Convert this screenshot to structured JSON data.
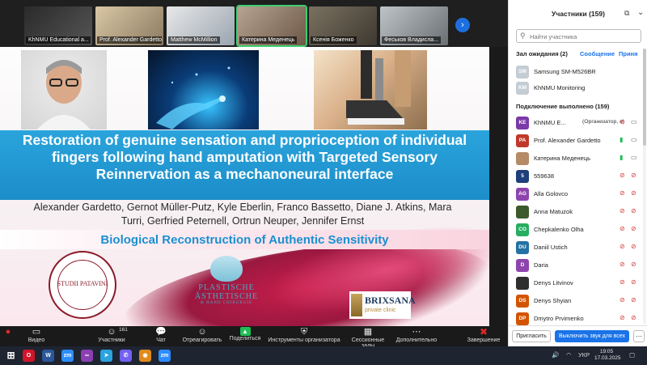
{
  "video_strip": {
    "tiles": [
      {
        "name": "KhNMU Educational a..."
      },
      {
        "name": "Prof. Alexander Gardetto"
      },
      {
        "name": "Matthew McMillion"
      },
      {
        "name": "Катерина Меденець"
      },
      {
        "name": "Ксенія Боженко"
      },
      {
        "name": "Феськов Владисла..."
      }
    ],
    "next_icon": "chevron-right"
  },
  "slide": {
    "title": "Restoration of genuine sensation and proprioception of individual fingers following hand amputation with Targeted Sensory Reinnervation as a mechanoneural interface",
    "authors": "Alexander Gardetto, Gernot Müller-Putz, Kyle Eberlin, Franco Bassetto, Diane J. Atkins, Mara Turri, Gerfried Peternell, Ortrun Neuper, Jennifer Ernst",
    "subtitle": "Biological Reconstruction of Authentic Sensitivity",
    "seal_text": "STUDII PATAVINI",
    "logo_plast_line1": "PLASTISCHE",
    "logo_plast_line2": "ÄSTHETISCHE",
    "logo_plast_line3": "& HAND CHIRURGIE",
    "logo_brix_name": "BRIXSANA",
    "logo_brix_sub": "private clinic"
  },
  "toolbar": {
    "items": [
      {
        "label": "",
        "icon": "mic-icon"
      },
      {
        "label": "Видео",
        "icon": "video-icon"
      },
      {
        "label": "Участники",
        "icon": "participants-icon",
        "count": "161"
      },
      {
        "label": "Чат",
        "icon": "chat-icon"
      },
      {
        "label": "Отреагировать",
        "icon": "react-icon"
      },
      {
        "label": "Поделиться",
        "icon": "share-icon"
      },
      {
        "label": "Инструменты организатора",
        "icon": "shield-icon"
      },
      {
        "label": "Сессионные залы",
        "icon": "rooms-icon"
      },
      {
        "label": "Дополнительно",
        "icon": "more-icon"
      },
      {
        "label": "Завершение",
        "icon": "end-icon"
      }
    ]
  },
  "panel": {
    "title": "Участники (159)",
    "search_placeholder": "Найти участника",
    "waiting": {
      "label": "Зал ожидания (2)",
      "message_link": "Сообщение",
      "admit_link": "Приня",
      "people": [
        {
          "initials": "SM",
          "name": "Samsung SM-M526BR",
          "color": "#c4ccd4"
        },
        {
          "initials": "KM",
          "name": "KhNMU Monitoring",
          "color": "#c4ccd4"
        }
      ]
    },
    "connected": {
      "label": "Подключение выполнено (159)",
      "people": [
        {
          "initials": "KE",
          "name": "KhNMU E...",
          "role": "(Организатор, я)",
          "color": "#7b3aa6",
          "mic": "off",
          "cam": "on"
        },
        {
          "initials": "PA",
          "name": "Prof. Alexander Gardetto",
          "role": "",
          "color": "#c0392b",
          "mic": "on",
          "cam": "on"
        },
        {
          "initials": "",
          "name": "Катерина Меденець",
          "role": "",
          "color": "#b58a66",
          "mic": "on",
          "cam": "on"
        },
        {
          "initials": "5",
          "name": "559638",
          "role": "",
          "color": "#1f3f7a",
          "mic": "off",
          "cam": "off"
        },
        {
          "initials": "AG",
          "name": "Alla Golovco",
          "role": "",
          "color": "#8e44ad",
          "mic": "off",
          "cam": "off"
        },
        {
          "initials": "",
          "name": "Anna Matuzok",
          "role": "",
          "color": "#3c5a2e",
          "mic": "off",
          "cam": "off"
        },
        {
          "initials": "CO",
          "name": "Chepkalenko Olha",
          "role": "",
          "color": "#27ae60",
          "mic": "off",
          "cam": "off"
        },
        {
          "initials": "DU",
          "name": "Daniil Ustich",
          "role": "",
          "color": "#2471a3",
          "mic": "off",
          "cam": "off"
        },
        {
          "initials": "D",
          "name": "Daria",
          "role": "",
          "color": "#8e44ad",
          "mic": "off",
          "cam": "off"
        },
        {
          "initials": "",
          "name": "Denys Litvinov",
          "role": "",
          "color": "#2f2f2f",
          "mic": "off",
          "cam": "off"
        },
        {
          "initials": "DS",
          "name": "Denys Shyian",
          "role": "",
          "color": "#d35400",
          "mic": "off",
          "cam": "off"
        },
        {
          "initials": "DP",
          "name": "Dmytro Prvimenko",
          "role": "",
          "color": "#d35400",
          "mic": "off",
          "cam": "off"
        }
      ]
    },
    "invite_label": "Пригласить",
    "mute_all_label": "Выключить звук для всех"
  },
  "taskbar": {
    "apps": [
      {
        "name": "opera",
        "glyph": "O",
        "color": "#d1152b"
      },
      {
        "name": "word",
        "glyph": "W",
        "color": "#2b579a"
      },
      {
        "name": "zoom",
        "glyph": "zm",
        "color": "#2d8cff"
      },
      {
        "name": "tool",
        "glyph": "∞",
        "color": "#8b3fb3"
      },
      {
        "name": "telegram",
        "glyph": "➤",
        "color": "#2aa3de"
      },
      {
        "name": "viber",
        "glyph": "✆",
        "color": "#7360f2"
      },
      {
        "name": "app",
        "glyph": "◉",
        "color": "#e08a1c"
      },
      {
        "name": "zoom2",
        "glyph": "zm",
        "color": "#2d8cff"
      }
    ],
    "lang": "УКР",
    "time": "19:05",
    "date": "17.03.2025"
  }
}
